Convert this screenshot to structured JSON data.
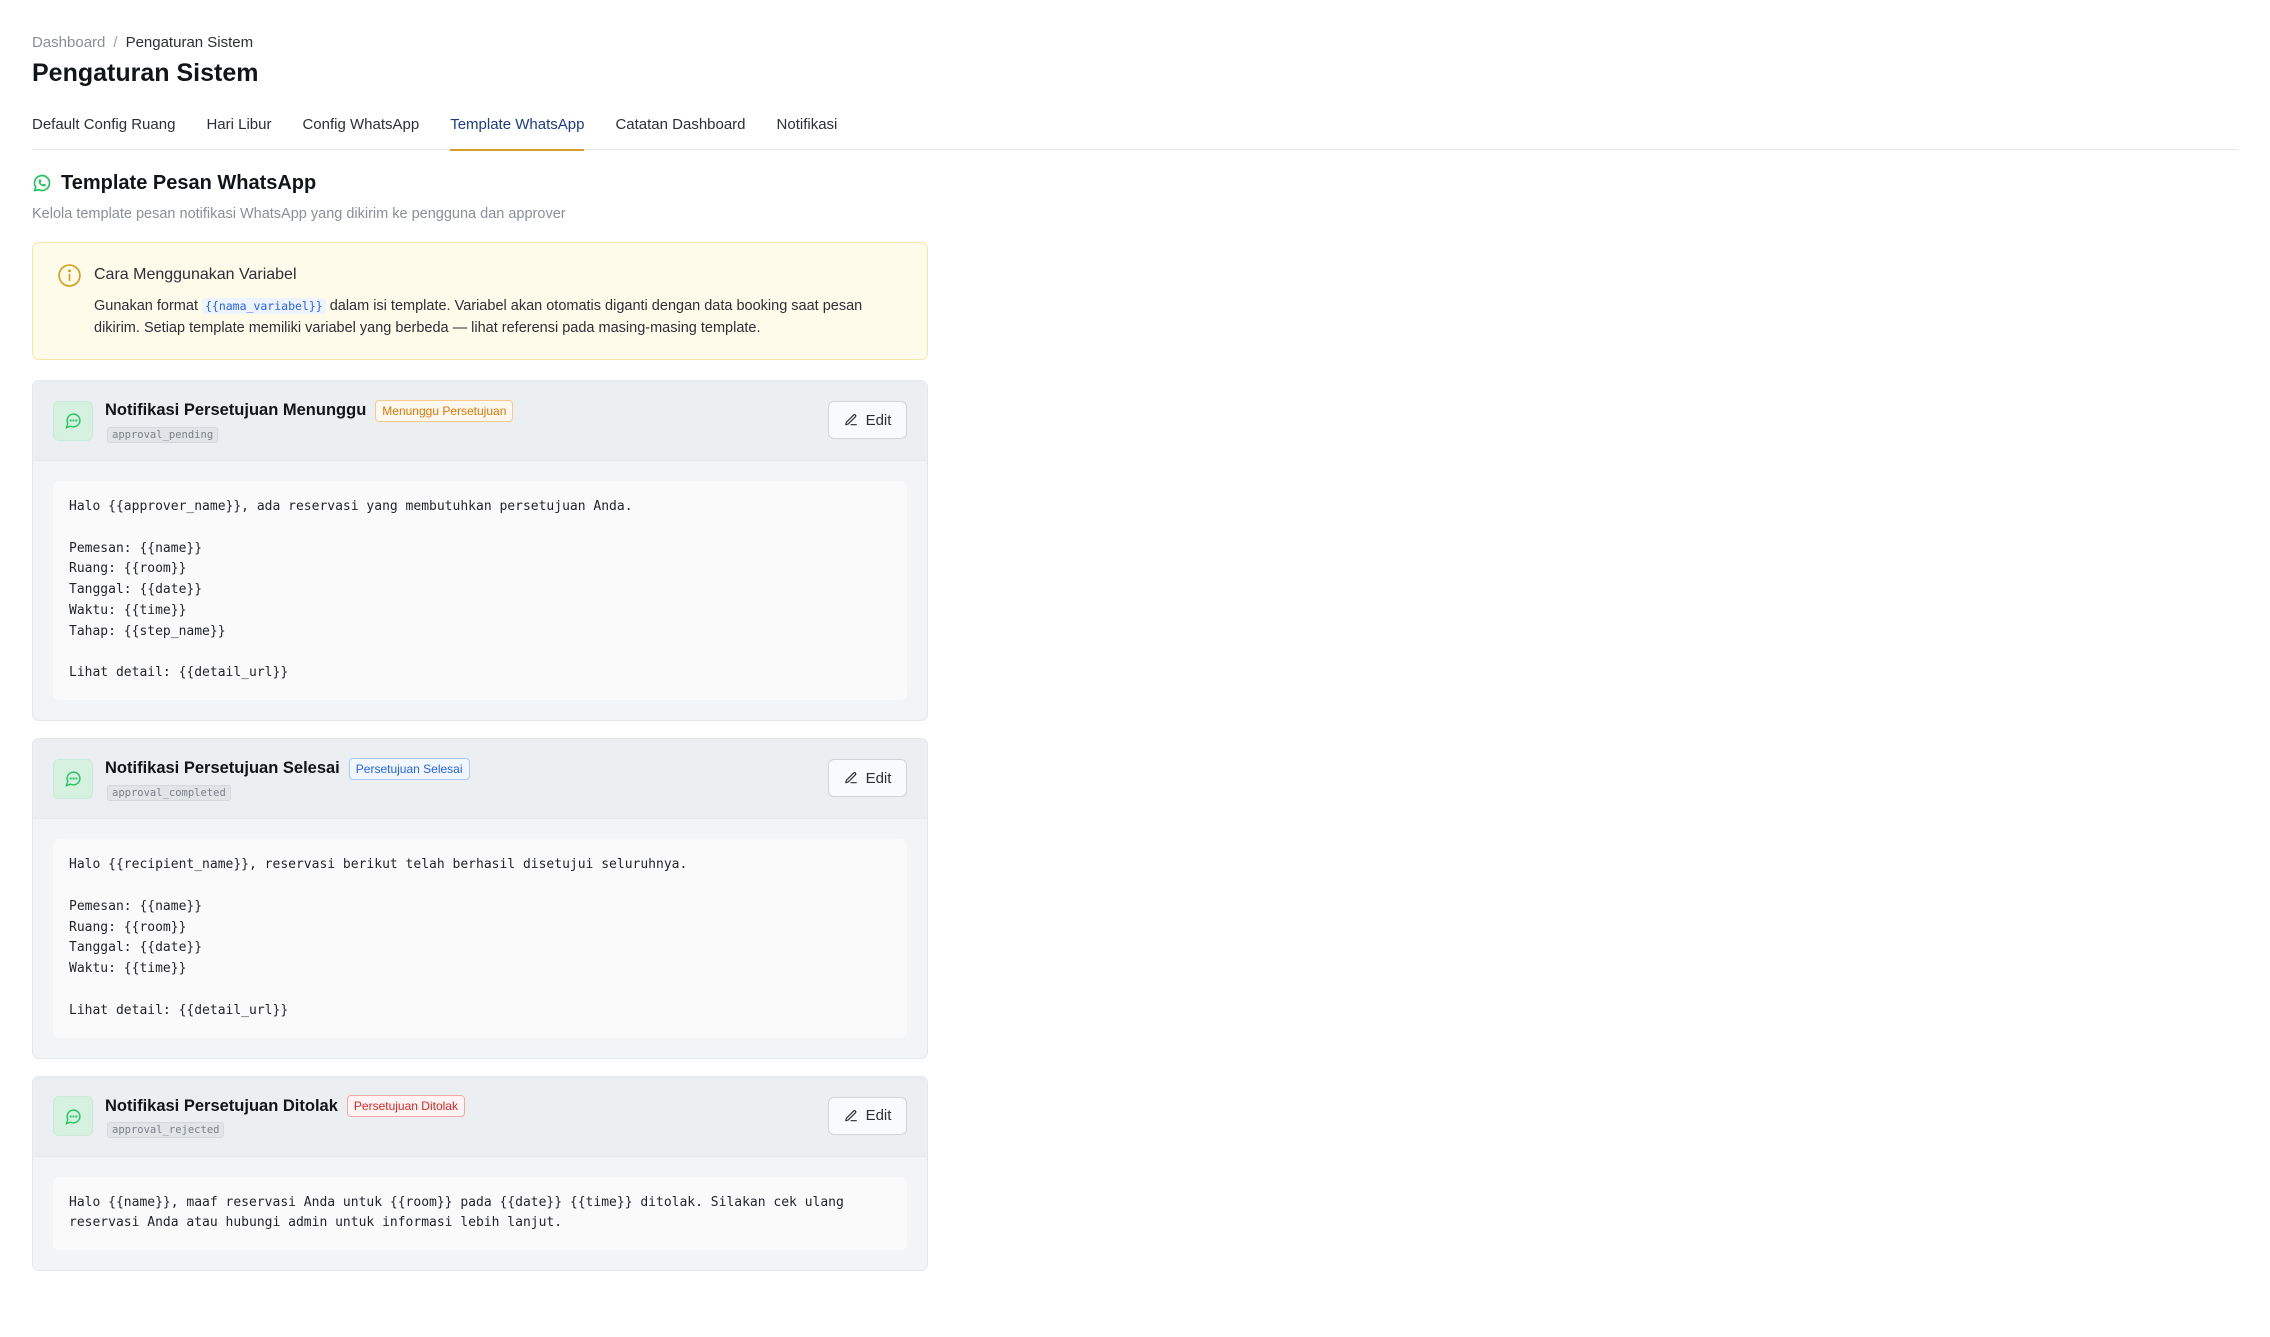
{
  "breadcrumb": {
    "root": "Dashboard",
    "separator": "/",
    "current": "Pengaturan Sistem"
  },
  "page_title": "Pengaturan Sistem",
  "tabs": [
    {
      "label": "Default Config Ruang",
      "active": false
    },
    {
      "label": "Hari Libur",
      "active": false
    },
    {
      "label": "Config WhatsApp",
      "active": false
    },
    {
      "label": "Template WhatsApp",
      "active": true
    },
    {
      "label": "Catatan Dashboard",
      "active": false
    },
    {
      "label": "Notifikasi",
      "active": false
    }
  ],
  "section": {
    "icon": "whatsapp-icon",
    "title": "Template Pesan WhatsApp",
    "subtitle": "Kelola template pesan notifikasi WhatsApp yang dikirim ke pengguna dan approver"
  },
  "info": {
    "icon": "info-circle-icon",
    "title": "Cara Menggunakan Variabel",
    "text_before": "Gunakan format",
    "code": "{{nama_variabel}}",
    "text_after": "dalam isi template. Variabel akan otomatis diganti dengan data booking saat pesan dikirim. Setiap template memiliki variabel yang berbeda — lihat referensi pada masing-masing template."
  },
  "templates": [
    {
      "icon": "message-circle-icon",
      "name": "Notifikasi Persetujuan Menunggu",
      "badge": "Menunggu Persetujuan",
      "key": "approval_pending",
      "edit_label": "Edit",
      "body": "Halo {{approver_name}}, ada reservasi yang membutuhkan persetujuan Anda.\n\nPemesan: {{name}}\nRuang: {{room}}\nTanggal: {{date}}\nWaktu: {{time}}\nTahap: {{step_name}}\n\nLihat detail: {{detail_url}}"
    },
    {
      "icon": "message-circle-icon",
      "name": "Notifikasi Persetujuan Selesai",
      "badge": "Persetujuan Selesai",
      "key": "approval_completed",
      "edit_label": "Edit",
      "body": "Halo {{recipient_name}}, reservasi berikut telah berhasil disetujui seluruhnya.\n\nPemesan: {{name}}\nRuang: {{room}}\nTanggal: {{date}}\nWaktu: {{time}}\n\nLihat detail: {{detail_url}}"
    },
    {
      "icon": "message-circle-icon",
      "name": "Notifikasi Persetujuan Ditolak",
      "badge": "Persetujuan Ditolak",
      "key": "approval_rejected",
      "edit_label": "Edit",
      "body": "Halo {{name}}, maaf reservasi Anda untuk {{room}} pada {{date}} {{time}} ditolak. Silakan cek ulang\nreservasi Anda atau hubungi admin untuk informasi lebih lanjut."
    }
  ],
  "colors": {
    "active_tab_text": "#1e3a8a",
    "active_tab_underline": "#d69e2e",
    "whatsapp_green": "#22c55e",
    "info_bg": "#fffbea",
    "info_icon": "#d4a017",
    "badge_pending": "#d97706",
    "badge_completed": "#2563eb",
    "badge_rejected": "#dc2626"
  }
}
